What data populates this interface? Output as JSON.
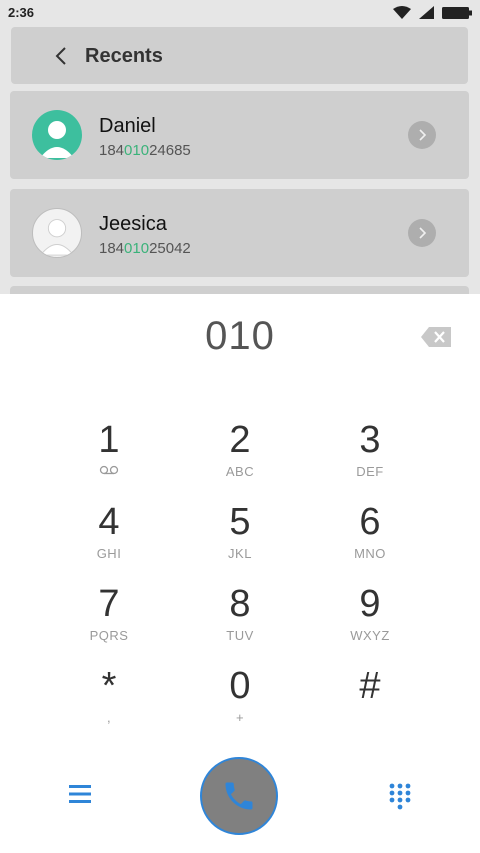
{
  "status": {
    "time": "2:36"
  },
  "header": {
    "title": "Recents"
  },
  "contacts": [
    {
      "name": "Daniel",
      "number_prefix": "184",
      "number_match": "010",
      "number_suffix": "24685",
      "avatar_color": "#3dbf9e"
    },
    {
      "name": "Jeesica",
      "number_prefix": "184",
      "number_match": "010",
      "number_suffix": "25042",
      "avatar_color": "#f2f2f2"
    }
  ],
  "dialer": {
    "input": "010"
  },
  "keypad": [
    {
      "digit": "1",
      "letters": ""
    },
    {
      "digit": "2",
      "letters": "ABC"
    },
    {
      "digit": "3",
      "letters": "DEF"
    },
    {
      "digit": "4",
      "letters": "GHI"
    },
    {
      "digit": "5",
      "letters": "JKL"
    },
    {
      "digit": "6",
      "letters": "MNO"
    },
    {
      "digit": "7",
      "letters": "PQRS"
    },
    {
      "digit": "8",
      "letters": "TUV"
    },
    {
      "digit": "9",
      "letters": "WXYZ"
    },
    {
      "digit": "*",
      "letters": ","
    },
    {
      "digit": "0",
      "letters": "+"
    },
    {
      "digit": "#",
      "letters": ""
    }
  ],
  "icons": {
    "wifi": "wifi-icon",
    "signal": "signal-icon",
    "battery": "battery-icon",
    "voicemail": "voicemail-icon",
    "menu": "menu-icon",
    "call": "phone-icon",
    "keypad": "dialpad-icon",
    "backspace": "backspace-icon",
    "back": "back-arrow-icon",
    "detail": "chevron-right-icon"
  },
  "colors": {
    "accent": "#2f85d8",
    "match_highlight": "#3bb27a",
    "call_button": "#808080"
  }
}
